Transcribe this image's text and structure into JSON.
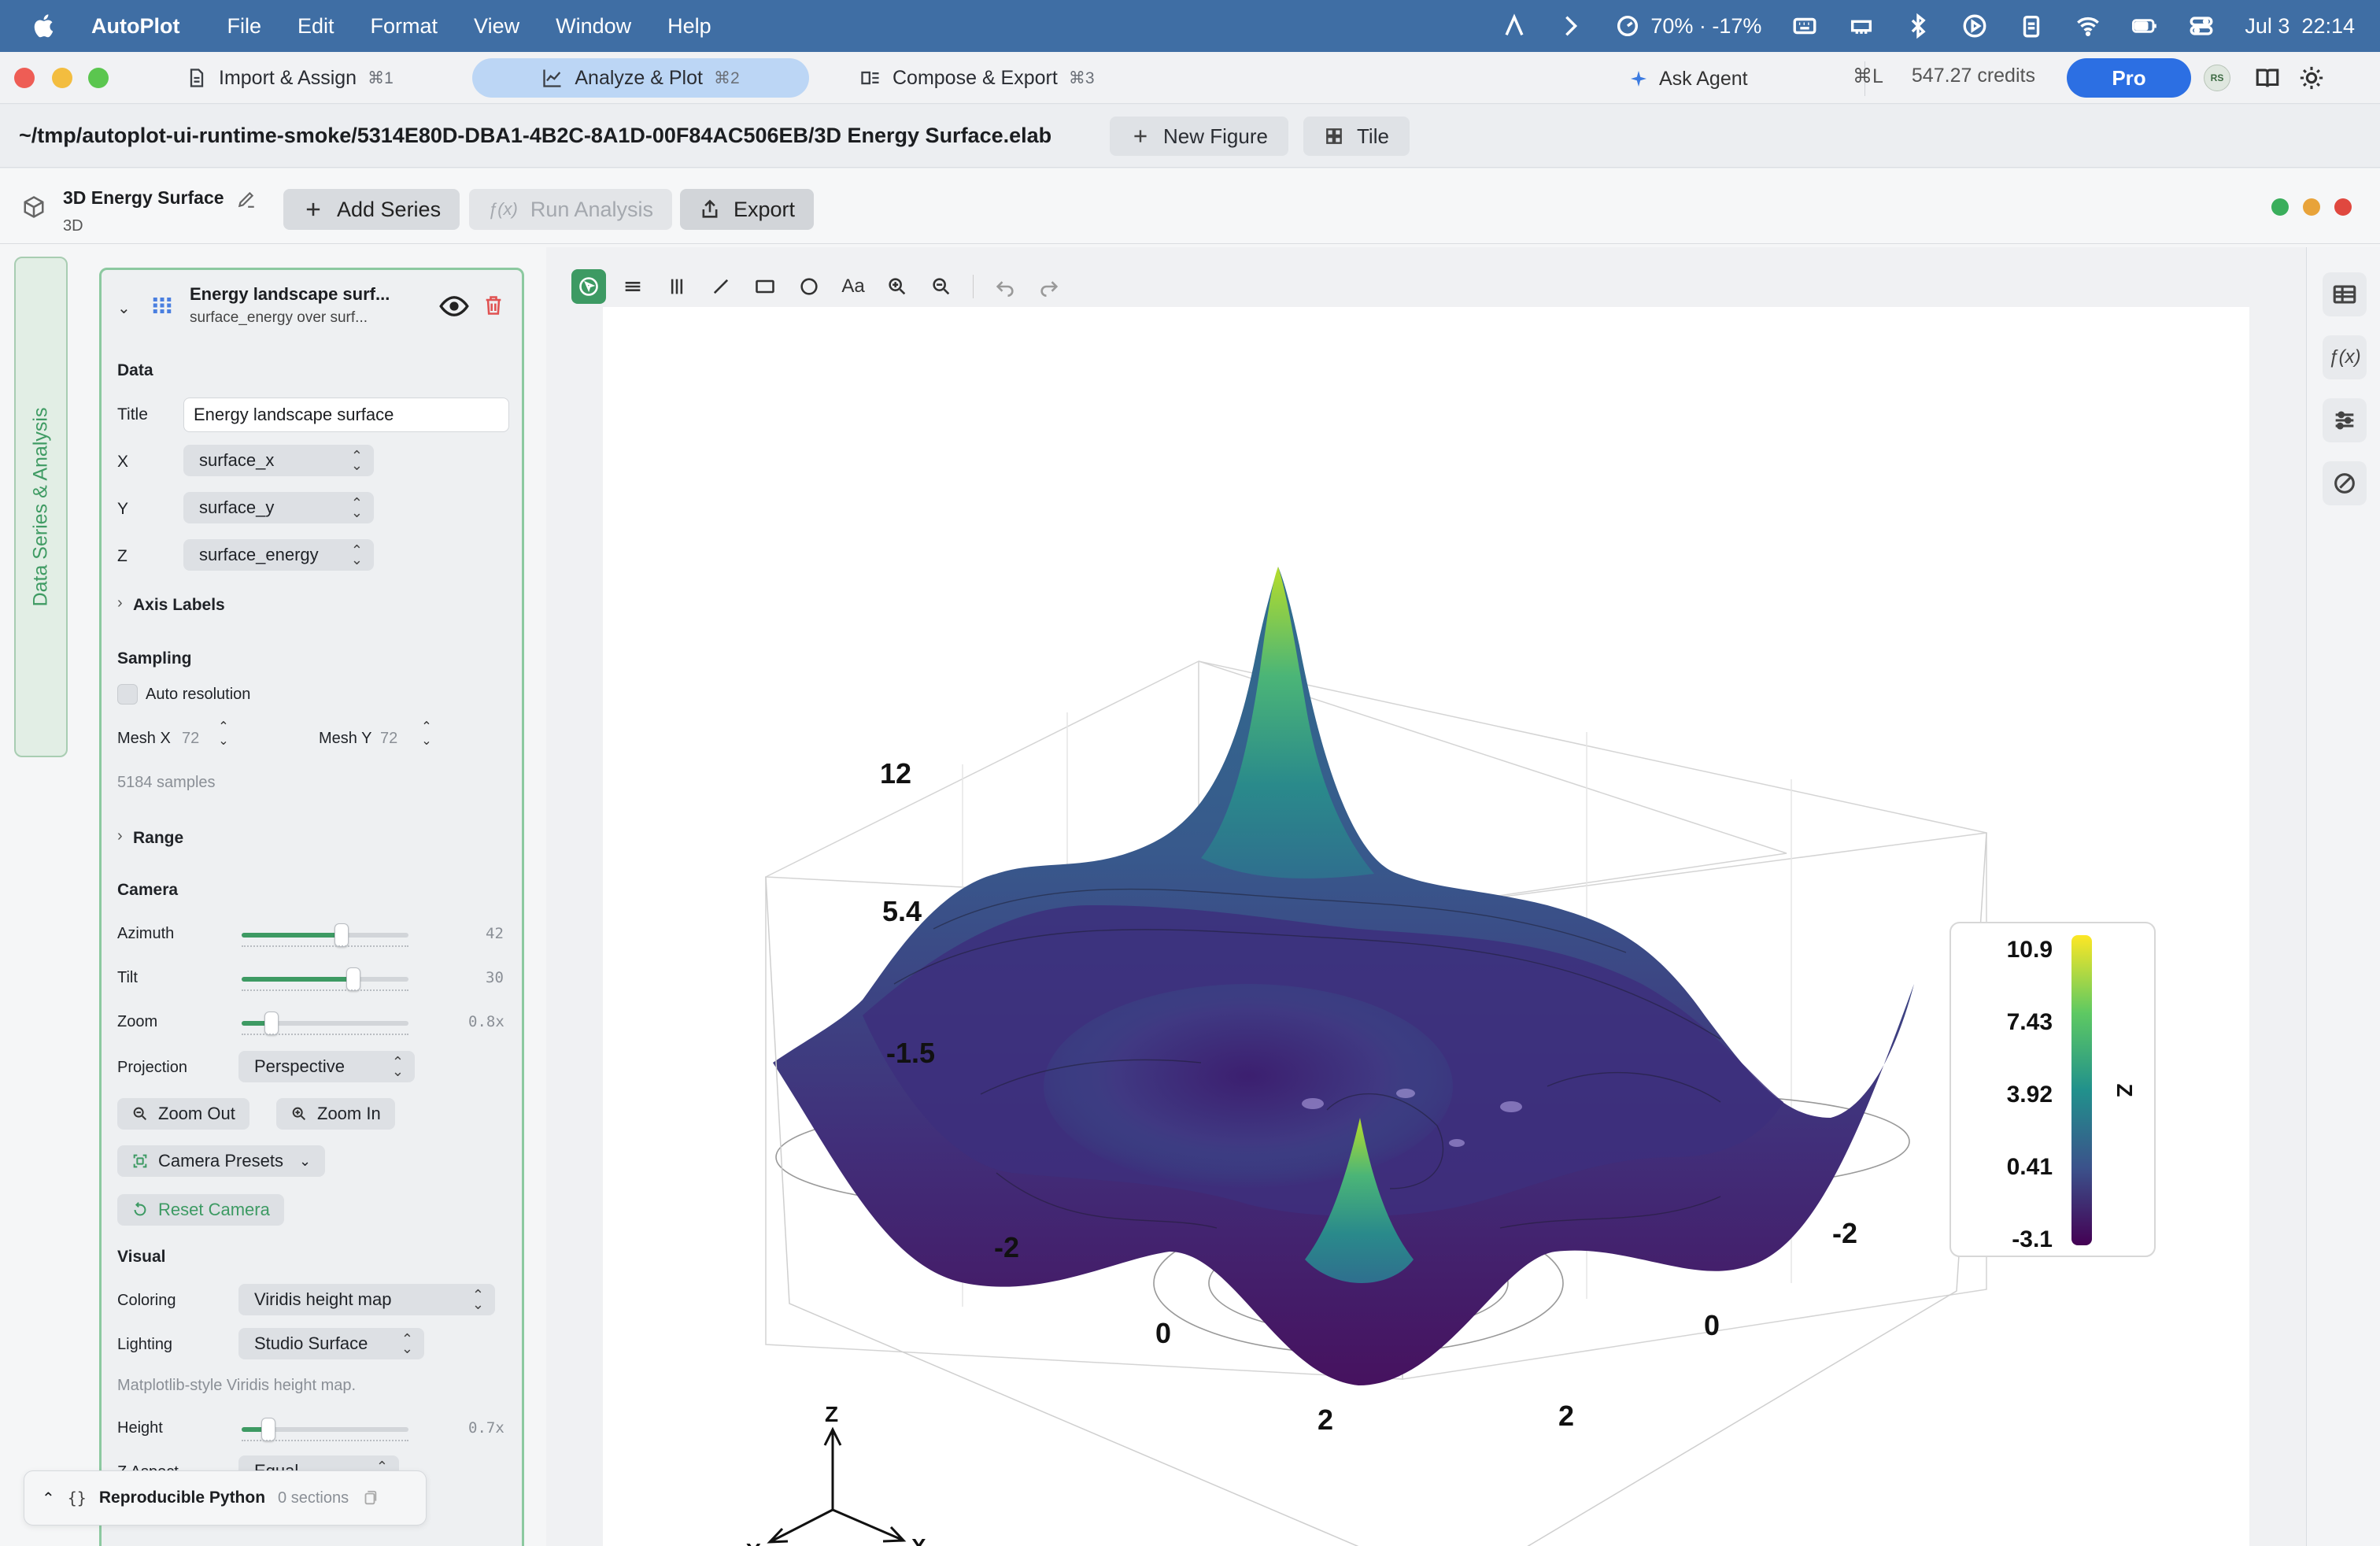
{
  "menubar": {
    "app_name": "AutoPlot",
    "items": [
      "File",
      "Edit",
      "Format",
      "View",
      "Window",
      "Help"
    ],
    "status": "70% · -17%",
    "clock": "Jul 3  22:14"
  },
  "tabs": [
    {
      "label": "Import & Assign",
      "shortcut": "⌘1",
      "icon": "document-icon"
    },
    {
      "label": "Analyze & Plot",
      "shortcut": "⌘2",
      "icon": "line-chart-icon",
      "active": true
    },
    {
      "label": "Compose & Export",
      "shortcut": "⌘3",
      "icon": "layout-icon"
    }
  ],
  "agent": {
    "label": "Ask Agent",
    "shortcut": "⌘L"
  },
  "credits": "547.27 credits",
  "pro_label": "Pro",
  "avatar_initials": "RS",
  "pathbar": {
    "path": "~/tmp/autoplot-ui-runtime-smoke/5314E80D-DBA1-4B2C-8A1D-00F84AC506EB/3D Energy Surface.elab",
    "new_figure": "New Figure",
    "tile": "Tile"
  },
  "document": {
    "title": "3D Energy Surface",
    "subtitle": "3D",
    "add_series": "Add Series",
    "run_analysis": "Run Analysis",
    "export": "Export"
  },
  "side_tab_label": "Data Series & Analysis",
  "series_panel": {
    "name": "Energy landscape surf...",
    "desc": "surface_energy over surf...",
    "data_heading": "Data",
    "title_label": "Title",
    "title_value": "Energy landscape surface",
    "x_label": "X",
    "x_value": "surface_x",
    "y_label": "Y",
    "y_value": "surface_y",
    "z_label": "Z",
    "z_value": "surface_energy",
    "axis_labels": "Axis Labels",
    "sampling_heading": "Sampling",
    "auto_resolution": "Auto resolution",
    "mesh_x_label": "Mesh X",
    "mesh_x_value": "72",
    "mesh_y_label": "Mesh Y",
    "mesh_y_value": "72",
    "samples": "5184 samples",
    "range": "Range",
    "camera_heading": "Camera",
    "azimuth_label": "Azimuth",
    "azimuth_value": "42",
    "azimuth_frac": 0.6,
    "tilt_label": "Tilt",
    "tilt_value": "30",
    "tilt_frac": 0.67,
    "zoom_label": "Zoom",
    "zoom_value": "0.8x",
    "zoom_frac": 0.18,
    "projection_label": "Projection",
    "projection_value": "Perspective",
    "zoom_out": "Zoom Out",
    "zoom_in": "Zoom In",
    "camera_presets": "Camera Presets",
    "reset_camera": "Reset Camera",
    "visual_heading": "Visual",
    "coloring_label": "Coloring",
    "coloring_value": "Viridis height map",
    "lighting_label": "Lighting",
    "lighting_value": "Studio Surface",
    "coloring_note": "Matplotlib-style Viridis height map.",
    "height_label": "Height",
    "height_value": "0.7x",
    "height_frac": 0.16,
    "zaspect_label": "Z Aspect",
    "zaspect_value": "Equal"
  },
  "repro": {
    "label": "Reproducible Python",
    "count": "0 sections"
  },
  "colors": {
    "menubar": "#3f6ea4",
    "accent_green": "#3d9a63",
    "pro_blue": "#2c6fe3",
    "active_tab": "#bcd6f5",
    "delete_red": "#e05252"
  },
  "chart_data": {
    "type": "surface3d",
    "colormap": "viridis",
    "z_ticks": [
      "12",
      "5.4",
      "-1.5"
    ],
    "x_ticks": [
      "-2",
      "0",
      "2"
    ],
    "y_ticks": [
      "-2",
      "0",
      "2"
    ],
    "colorbar": {
      "label": "Z",
      "ticks": [
        "10.9",
        "7.43",
        "3.92",
        "0.41",
        "-3.1"
      ],
      "min": -3.1,
      "max": 10.9
    },
    "axes_triad": [
      "Z",
      "Y",
      "X"
    ],
    "azimuth": 42,
    "tilt": 30
  }
}
